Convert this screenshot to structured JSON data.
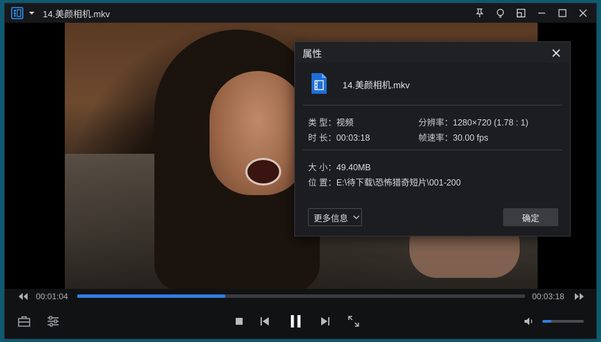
{
  "window": {
    "title": "14.美颜相机.mkv",
    "titlebar_icons": [
      "pin-icon",
      "bulb-icon",
      "mini-mode-icon",
      "minimize-icon",
      "maximize-icon",
      "close-icon"
    ]
  },
  "playback": {
    "current_time": "00:01:04",
    "total_time": "00:03:18",
    "progress_fraction": 0.33,
    "volume_fraction": 0.22,
    "state": "playing"
  },
  "dialog": {
    "title": "属性",
    "file_name": "14.美颜相机.mkv",
    "type_label": "类 型：",
    "type_value": "视频",
    "resolution_label": "分辨率：",
    "resolution_value": "1280×720 (1.78 : 1)",
    "duration_label": "时 长：",
    "duration_value": "00:03:18",
    "framerate_label": "帧速率：",
    "framerate_value": "30.00 fps",
    "size_label": "大 小：",
    "size_value": "49.40MB",
    "location_label": "位 置：",
    "location_value": "E:\\待下载\\恐怖猎奇短片\\001-200",
    "more_info_label": "更多信息",
    "ok_label": "确定"
  },
  "colors": {
    "accent": "#2f7fe0",
    "window_bg": "#111214",
    "dialog_bg": "#1c1d20"
  }
}
